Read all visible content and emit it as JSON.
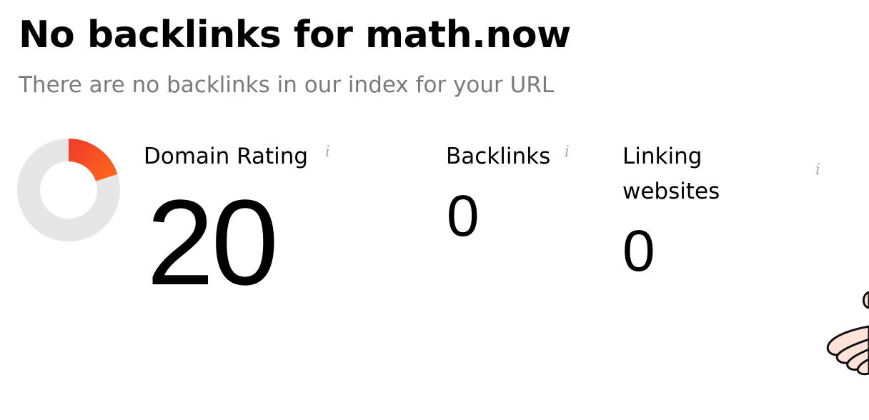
{
  "header": {
    "title": "No backlinks for math.now",
    "subtitle": "There are no backlinks in our index for your URL"
  },
  "metrics": {
    "domain_rating": {
      "label": "Domain Rating",
      "value": "20",
      "gauge_fraction": 0.2,
      "info_glyph": "i"
    },
    "backlinks": {
      "label": "Backlinks",
      "value": "0",
      "info_glyph": "i"
    },
    "linking_websites": {
      "label": "Linking websites",
      "value": "0",
      "info_glyph": "i"
    }
  },
  "icons": {
    "info": "info-icon",
    "hand": "hand-illustration"
  },
  "colors": {
    "gauge_start": "#ee3a2c",
    "gauge_end": "#ff6a1a",
    "gauge_track": "#e6e6e6",
    "subtitle": "#7a7a7a",
    "info_icon": "#a6a6a6",
    "hand_fill": "#fde3d8"
  }
}
